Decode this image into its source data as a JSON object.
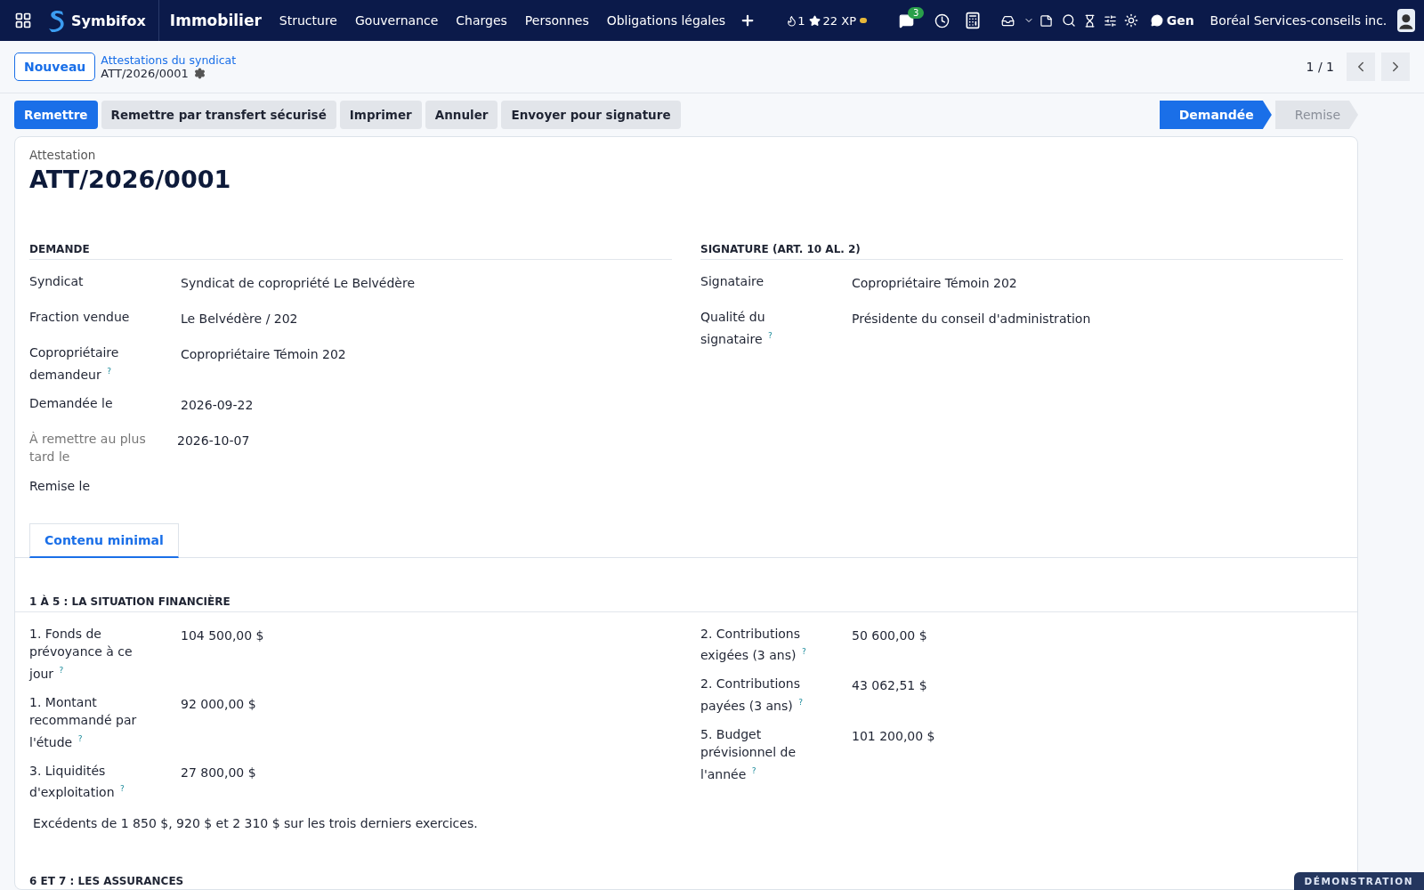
{
  "navbar": {
    "brand": "Symbifox",
    "app": "Immobilier",
    "menu": [
      "Structure",
      "Gouvernance",
      "Charges",
      "Personnes",
      "Obligations légales"
    ],
    "streak": "1",
    "xp": "22 XP",
    "chat_badge": "3",
    "chat_label": "Gen",
    "company": "Boréal Services-conseils inc."
  },
  "control_panel": {
    "new_button": "Nouveau",
    "breadcrumb": "Attestations du syndicat",
    "record": "ATT/2026/0001",
    "pager": "1 / 1"
  },
  "actions": [
    {
      "label": "Remettre",
      "primary": true
    },
    {
      "label": "Remettre par transfert sécurisé",
      "primary": false
    },
    {
      "label": "Imprimer",
      "primary": false
    },
    {
      "label": "Annuler",
      "primary": false
    },
    {
      "label": "Envoyer pour signature",
      "primary": false
    }
  ],
  "status_bar": [
    {
      "label": "Demandée",
      "selected": true
    },
    {
      "label": "Remise",
      "selected": false
    }
  ],
  "form": {
    "caption": "Attestation",
    "title": "ATT/2026/0001",
    "groups": [
      {
        "title": "DEMANDE",
        "fields": [
          {
            "label": "Syndicat",
            "value": "Syndicat de copropriété Le Belvédère",
            "muted": false
          },
          {
            "label": "Fraction vendue",
            "value": "Le Belvédère / 202",
            "muted": false
          },
          {
            "label": "Copropriétaire demandeur $^{?}$",
            "value": "Copropriétaire Témoin 202",
            "muted": false
          },
          {
            "label": "Demandée le",
            "value": "2026-09-22",
            "muted": false
          },
          {
            "label": "À remettre au plus tard le",
            "value": "2026-10-07",
            "muted": true
          },
          {
            "label": "Remise le",
            "muted": false
          }
        ]
      },
      {
        "title": "SIGNATURE (ART. 10 AL. 2)",
        "fields": [
          {
            "label": "Signataire",
            "value": "Copropriétaire Témoin 202",
            "muted": false
          },
          {
            "label": "Qualité du signataire $^{?}$",
            "value": "Présidente du conseil d'administration",
            "muted": false
          }
        ]
      }
    ],
    "tabs": [
      {
        "label": "Contenu minimal",
        "selected": true
      }
    ],
    "section": {
      "title": "1 À 5 : LA SITUATION FINANCIÈRE",
      "left": [
        {
          "label": "1. Fonds de prévoyance à ce jour $^{?}$",
          "value": "104 500,00 $"
        },
        {
          "label": "1. Montant recommandé par l'étude $^{?}$",
          "value": "92 000,00 $"
        },
        {
          "label": "3. Liquidités d'exploitation $^{?}$",
          "value": "27 800,00 $"
        }
      ],
      "right": [
        {
          "label": "2. Contributions exigées (3 ans) $^{?}$",
          "value": "50 600,00 $"
        },
        {
          "label": "2. Contributions payées (3 ans) $^{?}$",
          "value": "43 062,51 $"
        },
        {
          "label": "5. Budget prévisionnel de l'année $^{?}$",
          "value": "101 200,00 $"
        }
      ],
      "note": "Excédents de 1 850 $, 920 $ et 2 310 $ sur les trois derniers exercices."
    },
    "next_section": "6 ET 7 : LES ASSURANCES"
  },
  "ribbon": "DÉMONSTRATION"
}
